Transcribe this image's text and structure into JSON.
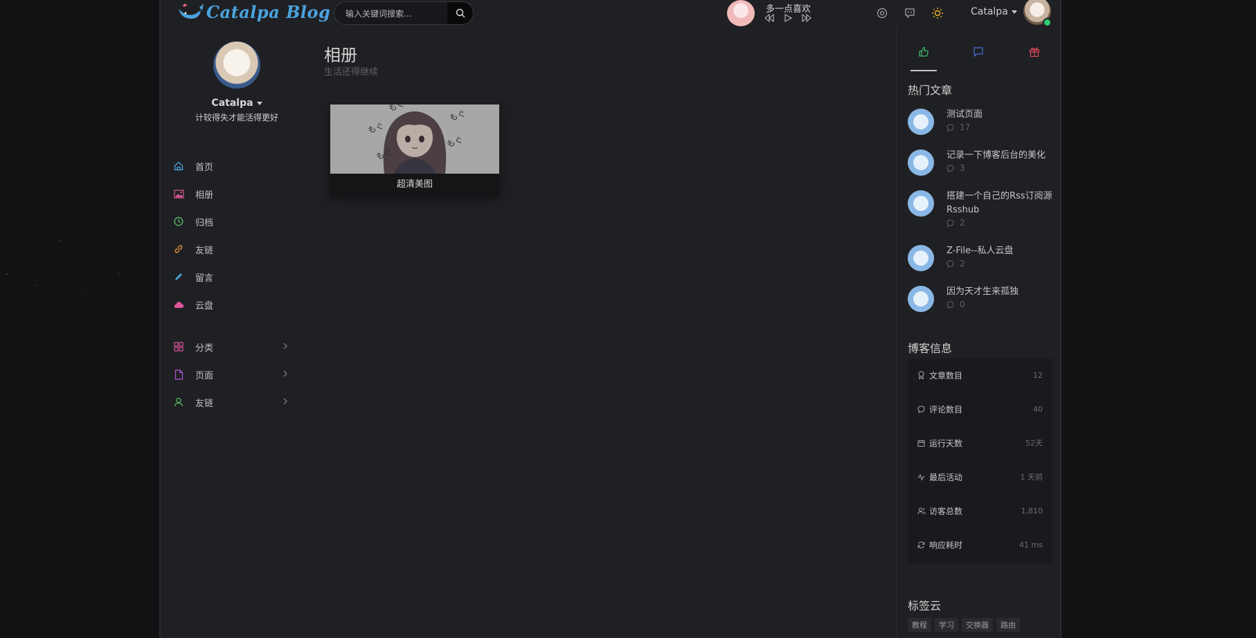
{
  "header": {
    "logo_text": "Catalpa Blog",
    "search_placeholder": "输入关键词搜索...",
    "music_title": "多一点喜欢",
    "user_name": "Catalpa"
  },
  "profile": {
    "name": "Catalpa",
    "bio": "计较得失才能活得更好"
  },
  "nav": {
    "items": [
      {
        "label": "首页",
        "icon": "home-icon",
        "color": "#4aa8e0"
      },
      {
        "label": "相册",
        "icon": "image-icon",
        "color": "#e0559a"
      },
      {
        "label": "归档",
        "icon": "clock-icon",
        "color": "#5cc26b"
      },
      {
        "label": "友链",
        "icon": "link-icon",
        "color": "#e0913a"
      },
      {
        "label": "留言",
        "icon": "pencil-icon",
        "color": "#4aa8e0"
      },
      {
        "label": "云盘",
        "icon": "cloud-icon",
        "color": "#e0559a"
      }
    ],
    "groups": [
      {
        "label": "分类",
        "icon": "grid-icon",
        "color": "#e0559a"
      },
      {
        "label": "页面",
        "icon": "file-icon",
        "color": "#b05ad8"
      },
      {
        "label": "友链",
        "icon": "user-icon",
        "color": "#5cc26b"
      }
    ]
  },
  "main": {
    "title": "相册",
    "subtitle": "生活还得继续",
    "albums": [
      {
        "caption": "超清美图",
        "image_text": [
          "もぐ",
          "もぐ",
          "もぐ",
          "もぐ",
          "もぐ"
        ]
      }
    ]
  },
  "sidebar": {
    "tabs": [
      {
        "icon": "thumbs-up-icon",
        "color": "#3fbf6e"
      },
      {
        "icon": "comment-icon",
        "color": "#4d6fe0"
      },
      {
        "icon": "gift-icon",
        "color": "#e04a5a"
      }
    ],
    "hot_title": "热门文章",
    "hot_posts": [
      {
        "title": "测试页面",
        "comments": "17"
      },
      {
        "title": "记录一下博客后台的美化",
        "comments": "3"
      },
      {
        "title": "搭建一个自己的Rss订阅源Rsshub",
        "comments": "2"
      },
      {
        "title": "Z-File--私人云盘",
        "comments": "2"
      },
      {
        "title": "因为天才生来孤独",
        "comments": "0"
      }
    ],
    "info_title": "博客信息",
    "info": [
      {
        "label": "文章数目",
        "value": "12",
        "icon": "award-icon"
      },
      {
        "label": "评论数目",
        "value": "40",
        "icon": "comment-icon"
      },
      {
        "label": "运行天数",
        "value": "52天",
        "icon": "calendar-icon"
      },
      {
        "label": "最后活动",
        "value": "1 天前",
        "icon": "activity-icon"
      },
      {
        "label": "访客总数",
        "value": "1,810",
        "icon": "users-icon"
      },
      {
        "label": "响应耗时",
        "value": "41 ms",
        "icon": "refresh-icon"
      }
    ],
    "tags_title": "标签云",
    "tags": [
      "教程",
      "学习",
      "交换器",
      "路由"
    ]
  }
}
